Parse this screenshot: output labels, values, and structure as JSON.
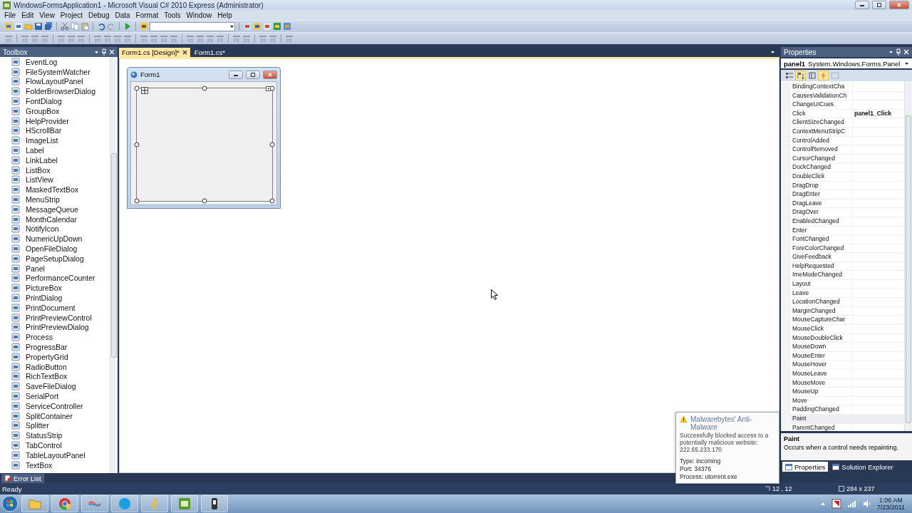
{
  "window": {
    "title": "WindowsFormsApplication1 - Microsoft Visual C# 2010 Express (Administrator)"
  },
  "menu": [
    "File",
    "Edit",
    "View",
    "Project",
    "Debug",
    "Data",
    "Format",
    "Tools",
    "Window",
    "Help"
  ],
  "toolbox": {
    "title": "Toolbox",
    "items": [
      "EventLog",
      "FileSystemWatcher",
      "FlowLayoutPanel",
      "FolderBrowserDialog",
      "FontDialog",
      "GroupBox",
      "HelpProvider",
      "HScrollBar",
      "ImageList",
      "Label",
      "LinkLabel",
      "ListBox",
      "ListView",
      "MaskedTextBox",
      "MenuStrip",
      "MessageQueue",
      "MonthCalendar",
      "NotifyIcon",
      "NumericUpDown",
      "OpenFileDialog",
      "PageSetupDialog",
      "Panel",
      "PerformanceCounter",
      "PictureBox",
      "PrintDialog",
      "PrintDocument",
      "PrintPreviewControl",
      "PrintPreviewDialog",
      "Process",
      "ProgressBar",
      "PropertyGrid",
      "RadioButton",
      "RichTextBox",
      "SaveFileDialog",
      "SerialPort",
      "ServiceController",
      "SplitContainer",
      "Splitter",
      "StatusStrip",
      "TabControl",
      "TableLayoutPanel",
      "TextBox"
    ]
  },
  "document_tabs": [
    {
      "label": "Form1.cs [Design]*",
      "selected": true
    },
    {
      "label": "Form1.cs*",
      "selected": false
    }
  ],
  "designer": {
    "form_title": "Form1",
    "panel_selected": true
  },
  "properties": {
    "title": "Properties",
    "object_name": "panel1",
    "object_type": "System.Windows.Forms.Panel",
    "toolbar": [
      {
        "kind": "categorized",
        "selected": false
      },
      {
        "kind": "alphabetical",
        "selected": true
      },
      {
        "kind": "properties",
        "selected": false
      },
      {
        "kind": "events",
        "selected": true
      },
      {
        "kind": "pages",
        "selected": false
      }
    ],
    "rows": [
      {
        "name": "BindingContextCha",
        "selected": false
      },
      {
        "name": "CausesValidationCh",
        "selected": false
      },
      {
        "name": "ChangeUICues",
        "selected": false
      },
      {
        "name": "Click",
        "value": "panel1_Click",
        "selected": false
      },
      {
        "name": "ClientSizeChanged",
        "selected": false
      },
      {
        "name": "ContextMenuStripC",
        "selected": false
      },
      {
        "name": "ControlAdded",
        "selected": false
      },
      {
        "name": "ControlRemoved",
        "selected": false
      },
      {
        "name": "CursorChanged",
        "selected": false
      },
      {
        "name": "DockChanged",
        "selected": false
      },
      {
        "name": "DoubleClick",
        "selected": false
      },
      {
        "name": "DragDrop",
        "selected": false
      },
      {
        "name": "DragEnter",
        "selected": false
      },
      {
        "name": "DragLeave",
        "selected": false
      },
      {
        "name": "DragOver",
        "selected": false
      },
      {
        "name": "EnabledChanged",
        "selected": false
      },
      {
        "name": "Enter",
        "selected": false
      },
      {
        "name": "FontChanged",
        "selected": false
      },
      {
        "name": "ForeColorChanged",
        "selected": false
      },
      {
        "name": "GiveFeedback",
        "selected": false
      },
      {
        "name": "HelpRequested",
        "selected": false
      },
      {
        "name": "ImeModeChanged",
        "selected": false
      },
      {
        "name": "Layout",
        "selected": false
      },
      {
        "name": "Leave",
        "selected": false
      },
      {
        "name": "LocationChanged",
        "selected": false
      },
      {
        "name": "MarginChanged",
        "selected": false
      },
      {
        "name": "MouseCaptureChar",
        "selected": false
      },
      {
        "name": "MouseClick",
        "selected": false
      },
      {
        "name": "MouseDoubleClick",
        "selected": false
      },
      {
        "name": "MouseDown",
        "selected": false
      },
      {
        "name": "MouseEnter",
        "selected": false
      },
      {
        "name": "MouseHover",
        "selected": false
      },
      {
        "name": "MouseLeave",
        "selected": false
      },
      {
        "name": "MouseMove",
        "selected": false
      },
      {
        "name": "MouseUp",
        "selected": false
      },
      {
        "name": "Move",
        "selected": false
      },
      {
        "name": "PaddingChanged",
        "selected": false
      },
      {
        "name": "Paint",
        "selected": true
      },
      {
        "name": "ParentChanged",
        "selected": false
      }
    ],
    "description": {
      "title": "Paint",
      "text": "Occurs when a control needs repainting."
    },
    "tabs": [
      {
        "label": "Properties",
        "selected": true
      },
      {
        "label": "Solution Explorer",
        "selected": false
      }
    ]
  },
  "bottom_tabs": [
    "Error List"
  ],
  "status_bar": {
    "text": "Ready",
    "position": "12 , 12",
    "size": "284 x 237"
  },
  "notification": {
    "title": "Malwarebytes' Anti-Malware",
    "message": "Successfully blocked access to a potentially malicious website: 222.65.233.170",
    "details": [
      "Type: incoming",
      "Port: 34376",
      "Process: utorrent.exe"
    ]
  },
  "taskbar": {
    "time": "1:06 AM",
    "date": "7/23/2011"
  }
}
